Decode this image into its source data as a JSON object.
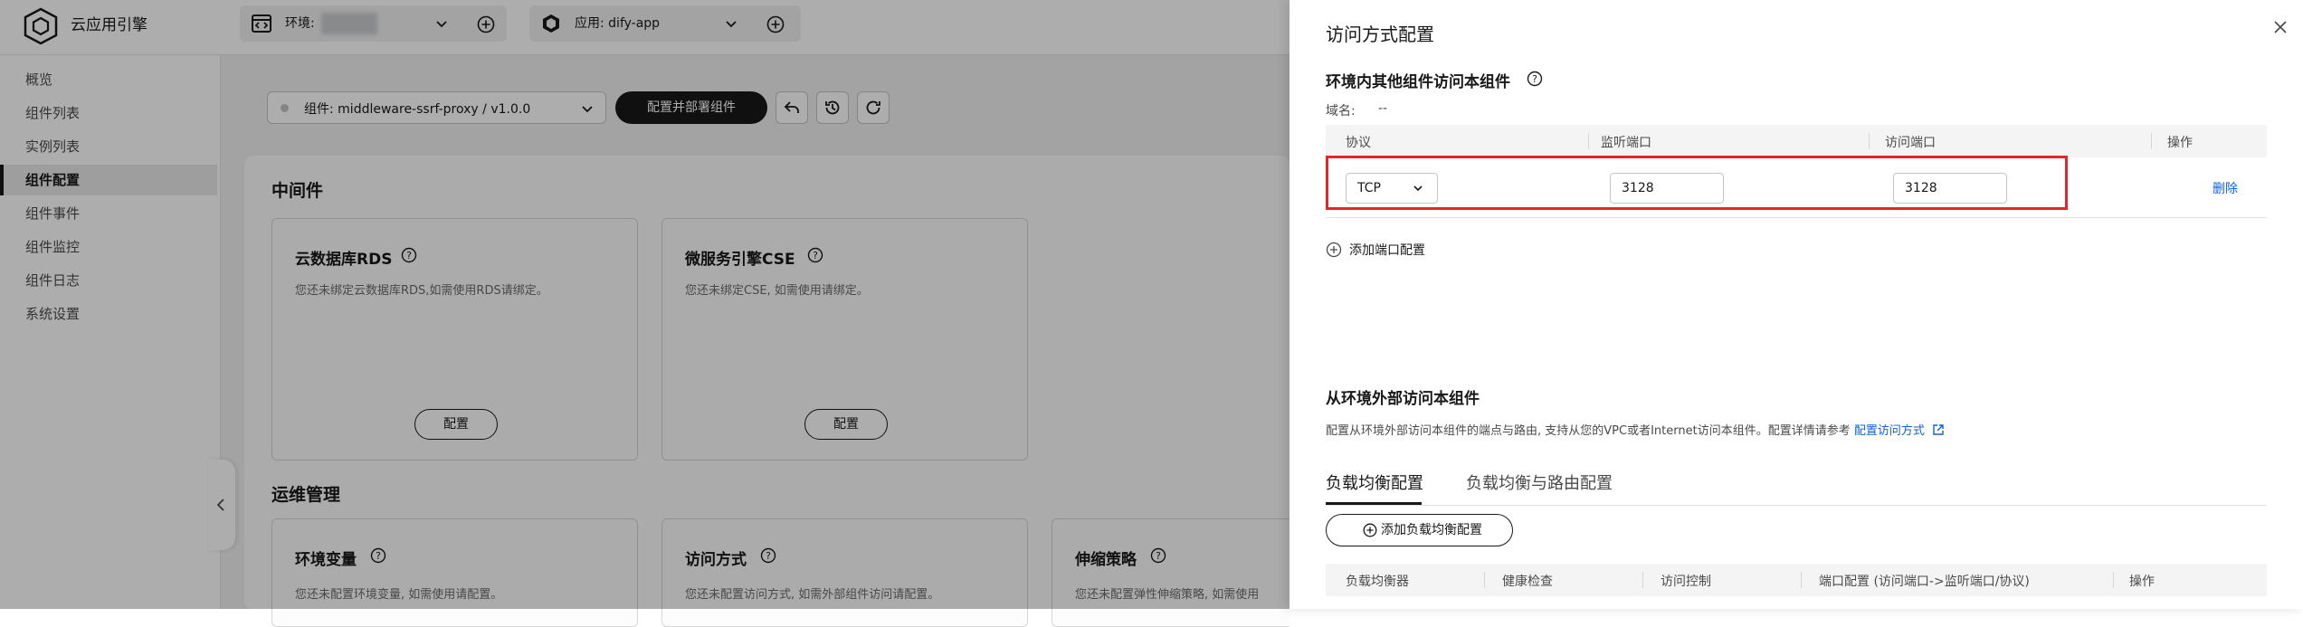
{
  "header": {
    "app_title": "云应用引擎",
    "env_label": "环境:",
    "app_label": "应用: dify-app"
  },
  "sidebar": {
    "items": [
      {
        "label": "概览"
      },
      {
        "label": "组件列表"
      },
      {
        "label": "实例列表"
      },
      {
        "label": "组件配置",
        "active": true
      },
      {
        "label": "组件事件"
      },
      {
        "label": "组件监控"
      },
      {
        "label": "组件日志"
      },
      {
        "label": "系统设置"
      }
    ]
  },
  "main": {
    "component_select": "组件: middleware-ssrf-proxy / v1.0.0",
    "deploy_button": "配置并部署组件",
    "middleware_title": "中间件",
    "cards": [
      {
        "title": "云数据库RDS",
        "desc": "您还未绑定云数据库RDS,如需使用RDS请绑定。",
        "button": "配置"
      },
      {
        "title": "微服务引擎CSE",
        "desc": "您还未绑定CSE, 如需使用请绑定。",
        "button": "配置"
      }
    ],
    "ops_title": "运维管理",
    "ops_cards": [
      {
        "title": "环境变量",
        "desc": "您还未配置环境变量, 如需使用请配置。"
      },
      {
        "title": "访问方式",
        "desc": "您还未配置访问方式, 如需外部组件访问请配置。"
      },
      {
        "title": "伸缩策略",
        "desc": "您还未配置弹性伸缩策略, 如需使用"
      }
    ]
  },
  "drawer": {
    "title": "访问方式配置",
    "internal_section": "环境内其他组件访问本组件",
    "domain_label": "域名:",
    "domain_value": "--",
    "table_headers": [
      "协议",
      "监听端口",
      "访问端口",
      "操作"
    ],
    "row": {
      "protocol": "TCP",
      "listen_port": "3128",
      "access_port": "3128",
      "action": "删除"
    },
    "add_port": "添加端口配置",
    "external_section": "从环境外部访问本组件",
    "external_desc": "配置从环境外部访问本组件的端点与路由, 支持从您的VPC或者Internet访问本组件。配置详情请参考",
    "external_link": "配置访问方式",
    "tabs": [
      {
        "label": "负载均衡配置",
        "active": true
      },
      {
        "label": "负载均衡与路由配置",
        "active": false
      }
    ],
    "add_lb": "添加负载均衡配置",
    "lb_headers": [
      "负载均衡器",
      "健康检查",
      "访问控制",
      "端口配置 (访问端口->监听端口/协议)",
      "操作"
    ]
  },
  "colors": {
    "primary": "#191919",
    "link": "#0d62d8",
    "highlight": "#e5252c"
  }
}
